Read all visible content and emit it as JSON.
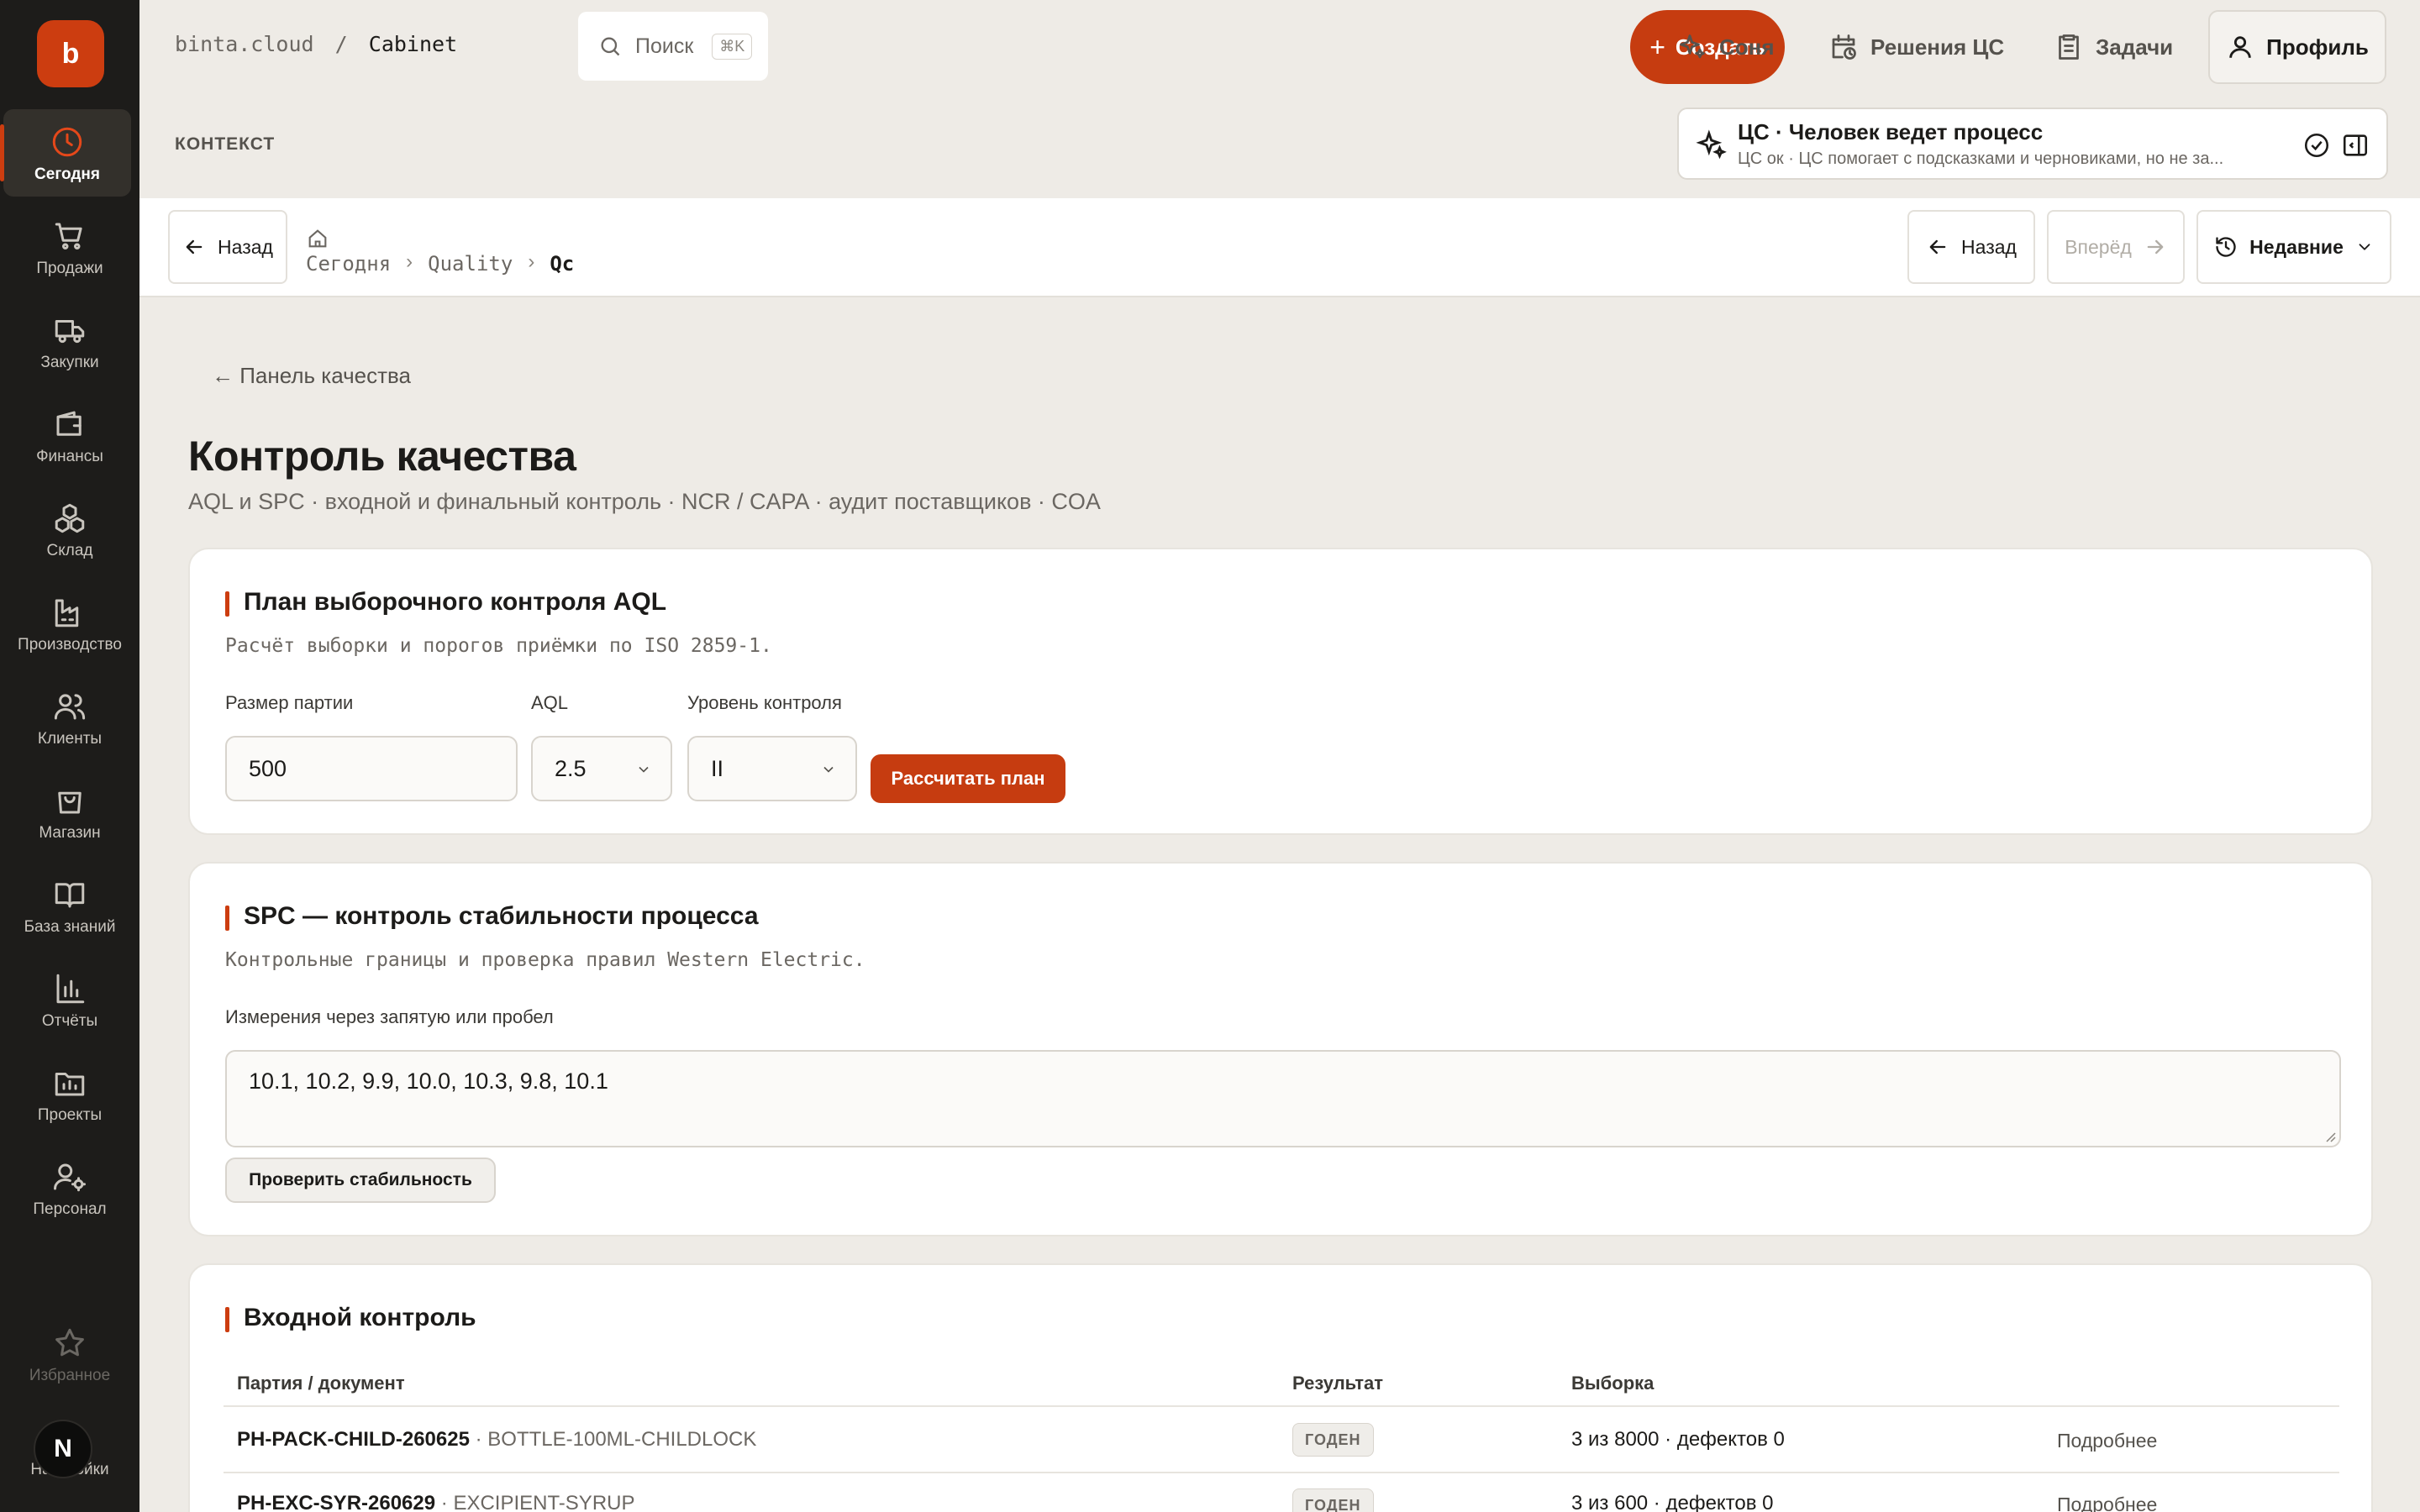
{
  "sidebar": {
    "logo": "b",
    "items": [
      {
        "label": "Сегодня",
        "icon": "clock-icon"
      },
      {
        "label": "Продажи",
        "icon": "cart-icon"
      },
      {
        "label": "Закупки",
        "icon": "truck-icon"
      },
      {
        "label": "Финансы",
        "icon": "wallet-icon"
      },
      {
        "label": "Склад",
        "icon": "boxes-icon"
      },
      {
        "label": "Производство",
        "icon": "factory-icon"
      },
      {
        "label": "Клиенты",
        "icon": "users-icon"
      },
      {
        "label": "Магазин",
        "icon": "bag-icon"
      },
      {
        "label": "База знаний",
        "icon": "book-icon"
      },
      {
        "label": "Отчёты",
        "icon": "bar-chart-icon"
      },
      {
        "label": "Проекты",
        "icon": "folder-chart-icon"
      },
      {
        "label": "Персонал",
        "icon": "user-gear-icon"
      }
    ],
    "favorites": "Избранное",
    "settings": "Настройки",
    "avatar": "N"
  },
  "topbar": {
    "domain": "binta.cloud",
    "separator": "/",
    "section": "Cabinet",
    "search_label": "Поиск",
    "search_shortcut": "⌘K",
    "create_label": "Создать",
    "links": [
      "Соня",
      "Решения ЦС",
      "Задачи"
    ],
    "profile_label": "Профиль",
    "context_label": "КОНТЕКСТ",
    "ai_title": "ЦС · Человек ведет процесс",
    "ai_subtitle": "ЦС ок · ЦС помогает с подсказками и черновиками, но не за..."
  },
  "navbar": {
    "back_label": "Назад",
    "breadcrumb": [
      "Сегодня",
      "Quality",
      "Qc"
    ],
    "history_back": "Назад",
    "history_forward": "Вперёд",
    "recent": "Недавние"
  },
  "page": {
    "back_link": "Панель качества",
    "title": "Контроль качества",
    "subtitle": "AQL и SPC · входной и финальный контроль · NCR / CAPA · аудит поставщиков · COA"
  },
  "aql": {
    "title": "План выборочного контроля AQL",
    "desc": "Расчёт выборки и порогов приёмки по ISO 2859-1.",
    "lot_label": "Размер партии",
    "lot_value": "500",
    "aql_label": "AQL",
    "aql_value": "2.5",
    "level_label": "Уровень контроля",
    "level_value": "II",
    "calc_button": "Рассчитать план"
  },
  "spc": {
    "title": "SPC — контроль стабильности процесса",
    "desc": "Контрольные границы и проверка правил Western Electric.",
    "input_label": "Измерения через запятую или пробел",
    "input_value": "10.1, 10.2, 9.9, 10.0, 10.3, 9.8, 10.1",
    "check_button": "Проверить стабильность"
  },
  "incoming": {
    "title": "Входной контроль",
    "columns": [
      "Партия / документ",
      "Результат",
      "Выборка"
    ],
    "rows": [
      {
        "batch": "PH-PACK-CHILD-260625",
        "doc": " · BOTTLE-100ML-CHILDLOCK",
        "result": "ГОДЕН",
        "sample": "3 из 8000 · дефектов 0",
        "more": "Подробнее"
      },
      {
        "batch": "PH-EXC-SYR-260629",
        "doc": " · EXCIPIENT-SYRUP",
        "result": "ГОДЕН",
        "sample": "3 из 600 · дефектов 0",
        "more": "Подробнее"
      }
    ]
  },
  "colors": {
    "accent": "#c63c10",
    "sidebar": "#1d1c1a",
    "background": "#eeebe6"
  }
}
